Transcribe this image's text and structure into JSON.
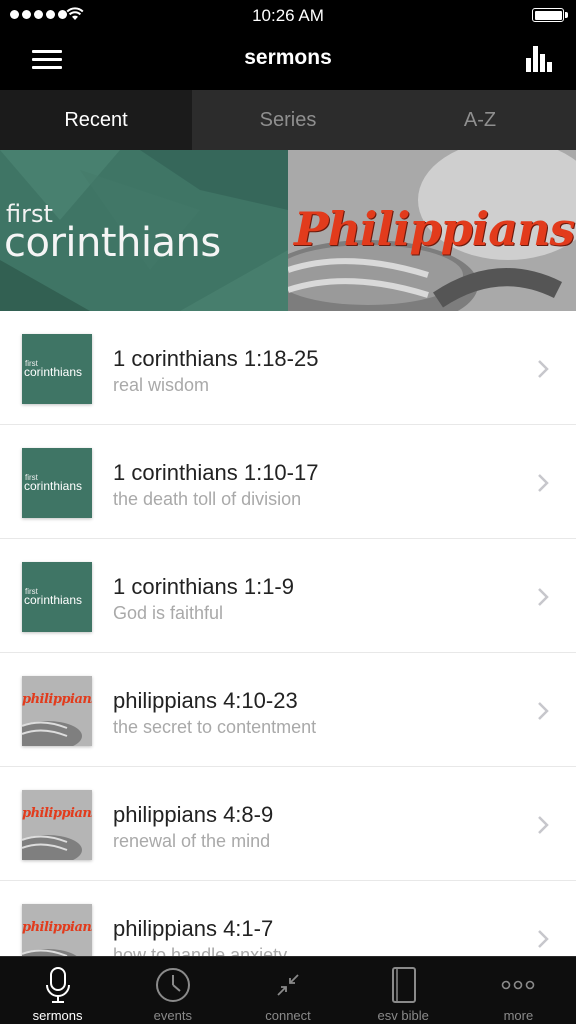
{
  "status_bar": {
    "time": "10:26 AM"
  },
  "nav": {
    "title": "sermons",
    "menu_icon": "hamburger-menu-icon",
    "right_icon": "bar-chart-icon"
  },
  "tabs": [
    {
      "label": "Recent",
      "active": true
    },
    {
      "label": "Series",
      "active": false
    },
    {
      "label": "A-Z",
      "active": false
    }
  ],
  "banners": [
    {
      "line1": "first",
      "line2": "corinthians"
    },
    {
      "line1": "Philippians"
    }
  ],
  "sermons": [
    {
      "title": "1 corinthians 1:18-25",
      "subtitle": "real wisdom",
      "thumb": {
        "line1": "first",
        "line2": "corinthians"
      }
    },
    {
      "title": "1 corinthians 1:10-17",
      "subtitle": "the death toll of division",
      "thumb": {
        "line1": "first",
        "line2": "corinthians"
      }
    },
    {
      "title": "1 corinthians 1:1-9",
      "subtitle": "God is faithful",
      "thumb": {
        "line1": "first",
        "line2": "corinthians"
      }
    },
    {
      "title": "philippians 4:10-23",
      "subtitle": "the secret to contentment",
      "thumb": {
        "line1": "philippians"
      }
    },
    {
      "title": "philippians 4:8-9",
      "subtitle": "renewal of the mind",
      "thumb": {
        "line1": "philippians"
      }
    },
    {
      "title": "philippians 4:1-7",
      "subtitle": "how to handle anxiety",
      "thumb": {
        "line1": "philippians"
      }
    }
  ],
  "tabbar": [
    {
      "label": "sermons",
      "icon": "microphone-icon",
      "active": true
    },
    {
      "label": "events",
      "icon": "clock-icon",
      "active": false
    },
    {
      "label": "connect",
      "icon": "connect-arrows-icon",
      "active": false
    },
    {
      "label": "esv bible",
      "icon": "book-icon",
      "active": false
    },
    {
      "label": "more",
      "icon": "more-dots-icon",
      "active": false
    }
  ]
}
